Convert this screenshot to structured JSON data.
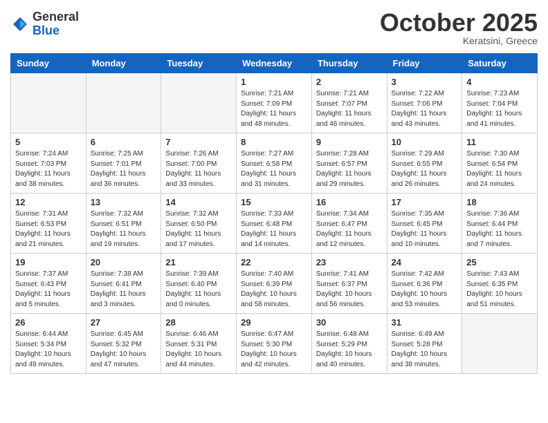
{
  "header": {
    "logo": {
      "line1": "General",
      "line2": "Blue"
    },
    "title": "October 2025",
    "location": "Keratsini, Greece"
  },
  "days_of_week": [
    "Sunday",
    "Monday",
    "Tuesday",
    "Wednesday",
    "Thursday",
    "Friday",
    "Saturday"
  ],
  "weeks": [
    [
      {
        "day": "",
        "info": ""
      },
      {
        "day": "",
        "info": ""
      },
      {
        "day": "",
        "info": ""
      },
      {
        "day": "1",
        "info": "Sunrise: 7:21 AM\nSunset: 7:09 PM\nDaylight: 11 hours\nand 48 minutes."
      },
      {
        "day": "2",
        "info": "Sunrise: 7:21 AM\nSunset: 7:07 PM\nDaylight: 11 hours\nand 46 minutes."
      },
      {
        "day": "3",
        "info": "Sunrise: 7:22 AM\nSunset: 7:06 PM\nDaylight: 11 hours\nand 43 minutes."
      },
      {
        "day": "4",
        "info": "Sunrise: 7:23 AM\nSunset: 7:04 PM\nDaylight: 11 hours\nand 41 minutes."
      }
    ],
    [
      {
        "day": "5",
        "info": "Sunrise: 7:24 AM\nSunset: 7:03 PM\nDaylight: 11 hours\nand 38 minutes."
      },
      {
        "day": "6",
        "info": "Sunrise: 7:25 AM\nSunset: 7:01 PM\nDaylight: 11 hours\nand 36 minutes."
      },
      {
        "day": "7",
        "info": "Sunrise: 7:26 AM\nSunset: 7:00 PM\nDaylight: 11 hours\nand 33 minutes."
      },
      {
        "day": "8",
        "info": "Sunrise: 7:27 AM\nSunset: 6:58 PM\nDaylight: 11 hours\nand 31 minutes."
      },
      {
        "day": "9",
        "info": "Sunrise: 7:28 AM\nSunset: 6:57 PM\nDaylight: 11 hours\nand 29 minutes."
      },
      {
        "day": "10",
        "info": "Sunrise: 7:29 AM\nSunset: 6:55 PM\nDaylight: 11 hours\nand 26 minutes."
      },
      {
        "day": "11",
        "info": "Sunrise: 7:30 AM\nSunset: 6:54 PM\nDaylight: 11 hours\nand 24 minutes."
      }
    ],
    [
      {
        "day": "12",
        "info": "Sunrise: 7:31 AM\nSunset: 6:53 PM\nDaylight: 11 hours\nand 21 minutes."
      },
      {
        "day": "13",
        "info": "Sunrise: 7:32 AM\nSunset: 6:51 PM\nDaylight: 11 hours\nand 19 minutes."
      },
      {
        "day": "14",
        "info": "Sunrise: 7:32 AM\nSunset: 6:50 PM\nDaylight: 11 hours\nand 17 minutes."
      },
      {
        "day": "15",
        "info": "Sunrise: 7:33 AM\nSunset: 6:48 PM\nDaylight: 11 hours\nand 14 minutes."
      },
      {
        "day": "16",
        "info": "Sunrise: 7:34 AM\nSunset: 6:47 PM\nDaylight: 11 hours\nand 12 minutes."
      },
      {
        "day": "17",
        "info": "Sunrise: 7:35 AM\nSunset: 6:45 PM\nDaylight: 11 hours\nand 10 minutes."
      },
      {
        "day": "18",
        "info": "Sunrise: 7:36 AM\nSunset: 6:44 PM\nDaylight: 11 hours\nand 7 minutes."
      }
    ],
    [
      {
        "day": "19",
        "info": "Sunrise: 7:37 AM\nSunset: 6:43 PM\nDaylight: 11 hours\nand 5 minutes."
      },
      {
        "day": "20",
        "info": "Sunrise: 7:38 AM\nSunset: 6:41 PM\nDaylight: 11 hours\nand 3 minutes."
      },
      {
        "day": "21",
        "info": "Sunrise: 7:39 AM\nSunset: 6:40 PM\nDaylight: 11 hours\nand 0 minutes."
      },
      {
        "day": "22",
        "info": "Sunrise: 7:40 AM\nSunset: 6:39 PM\nDaylight: 10 hours\nand 58 minutes."
      },
      {
        "day": "23",
        "info": "Sunrise: 7:41 AM\nSunset: 6:37 PM\nDaylight: 10 hours\nand 56 minutes."
      },
      {
        "day": "24",
        "info": "Sunrise: 7:42 AM\nSunset: 6:36 PM\nDaylight: 10 hours\nand 53 minutes."
      },
      {
        "day": "25",
        "info": "Sunrise: 7:43 AM\nSunset: 6:35 PM\nDaylight: 10 hours\nand 51 minutes."
      }
    ],
    [
      {
        "day": "26",
        "info": "Sunrise: 6:44 AM\nSunset: 5:34 PM\nDaylight: 10 hours\nand 49 minutes."
      },
      {
        "day": "27",
        "info": "Sunrise: 6:45 AM\nSunset: 5:32 PM\nDaylight: 10 hours\nand 47 minutes."
      },
      {
        "day": "28",
        "info": "Sunrise: 6:46 AM\nSunset: 5:31 PM\nDaylight: 10 hours\nand 44 minutes."
      },
      {
        "day": "29",
        "info": "Sunrise: 6:47 AM\nSunset: 5:30 PM\nDaylight: 10 hours\nand 42 minutes."
      },
      {
        "day": "30",
        "info": "Sunrise: 6:48 AM\nSunset: 5:29 PM\nDaylight: 10 hours\nand 40 minutes."
      },
      {
        "day": "31",
        "info": "Sunrise: 6:49 AM\nSunset: 5:28 PM\nDaylight: 10 hours\nand 38 minutes."
      },
      {
        "day": "",
        "info": ""
      }
    ]
  ]
}
